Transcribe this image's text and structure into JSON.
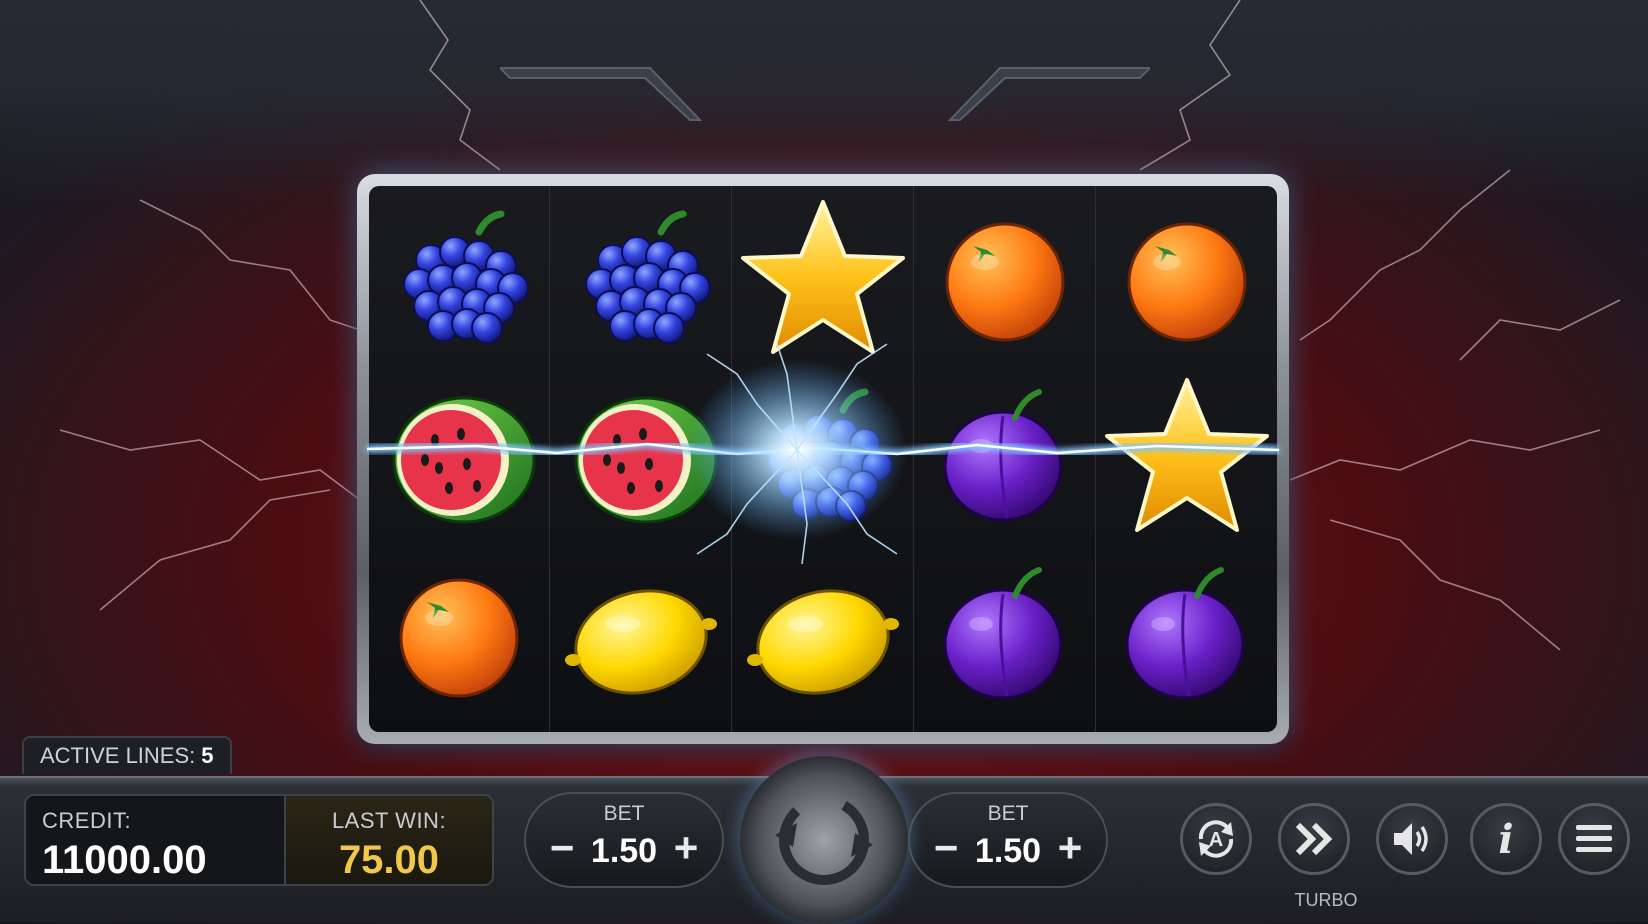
{
  "game": {
    "reels": [
      [
        "grapes",
        "watermelon",
        "orange"
      ],
      [
        "grapes",
        "watermelon",
        "lemon"
      ],
      [
        "star",
        "grapes",
        "lemon"
      ],
      [
        "orange",
        "plum",
        "plum"
      ],
      [
        "orange",
        "star",
        "plum"
      ]
    ],
    "winning_line": "middle-row"
  },
  "status": {
    "active_lines_label": "ACTIVE LINES:",
    "active_lines_value": "5"
  },
  "panel": {
    "credit_label": "CREDIT:",
    "credit_value": "11000.00",
    "last_win_label": "LAST WIN:",
    "last_win_value": "75.00"
  },
  "bet_left": {
    "label": "BET",
    "value": "1.50",
    "minus": "−",
    "plus": "+"
  },
  "bet_right": {
    "label": "BET",
    "value": "1.50",
    "minus": "−",
    "plus": "+"
  },
  "buttons": {
    "spin_icon": "spin-arrow-icon",
    "autoplay_icon": "autoplay-icon",
    "autoplay_letter": "A",
    "turbo_icon": "fast-forward-icon",
    "turbo_label": "TURBO",
    "sound_icon": "speaker-icon",
    "info_icon": "info-icon",
    "info_glyph": "i",
    "menu_icon": "hamburger-menu-icon"
  },
  "colors": {
    "background_red": "#7a1418",
    "win_gold": "#f2c84b",
    "lightning_blue": "#8fd0ff"
  }
}
